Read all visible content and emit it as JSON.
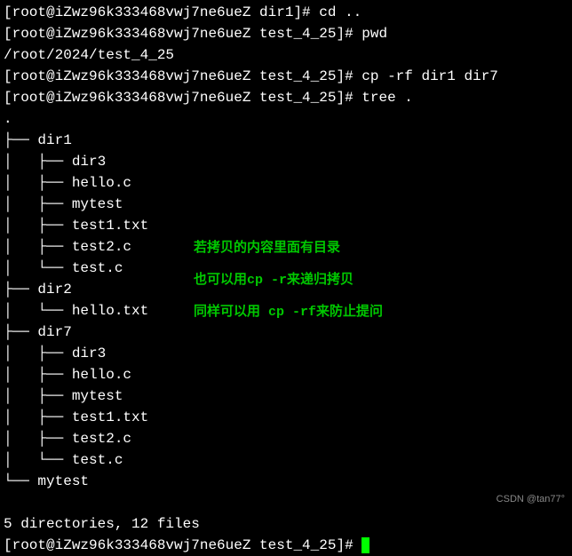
{
  "prompts": {
    "p1": "[root@iZwz96k333468vwj7ne6ueZ dir1]# ",
    "p2": "[root@iZwz96k333468vwj7ne6ueZ test_4_25]# ",
    "p3": "[root@iZwz96k333468vwj7ne6ueZ test_4_25]# ",
    "p4": "[root@iZwz96k333468vwj7ne6ueZ test_4_25]# ",
    "p5": "[root@iZwz96k333468vwj7ne6ueZ test_4_25]# "
  },
  "commands": {
    "c1": "cd ..",
    "c2": "pwd",
    "c3": "cp -rf dir1 dir7",
    "c4": "tree ."
  },
  "pwd_output": "/root/2024/test_4_25",
  "tree": {
    "root": ".",
    "l1": "├── dir1",
    "l2": "│   ├── dir3",
    "l3": "│   ├── hello.c",
    "l4": "│   ├── mytest",
    "l5": "│   ├── test1.txt",
    "l6": "│   ├── test2.c",
    "l7": "│   └── test.c",
    "l8": "├── dir2",
    "l9": "│   └── hello.txt",
    "l10": "├── dir7",
    "l11": "│   ├── dir3",
    "l12": "│   ├── hello.c",
    "l13": "│   ├── mytest",
    "l14": "│   ├── test1.txt",
    "l15": "│   ├── test2.c",
    "l16": "│   └── test.c",
    "l17": "└── mytest",
    "summary": "5 directories, 12 files"
  },
  "annotations": {
    "a1": "若拷贝的内容里面有目录",
    "a2": "也可以用cp -r来递归拷贝",
    "a3": "同样可以用 cp -rf来防止提问"
  },
  "watermark": "CSDN @tan77°"
}
